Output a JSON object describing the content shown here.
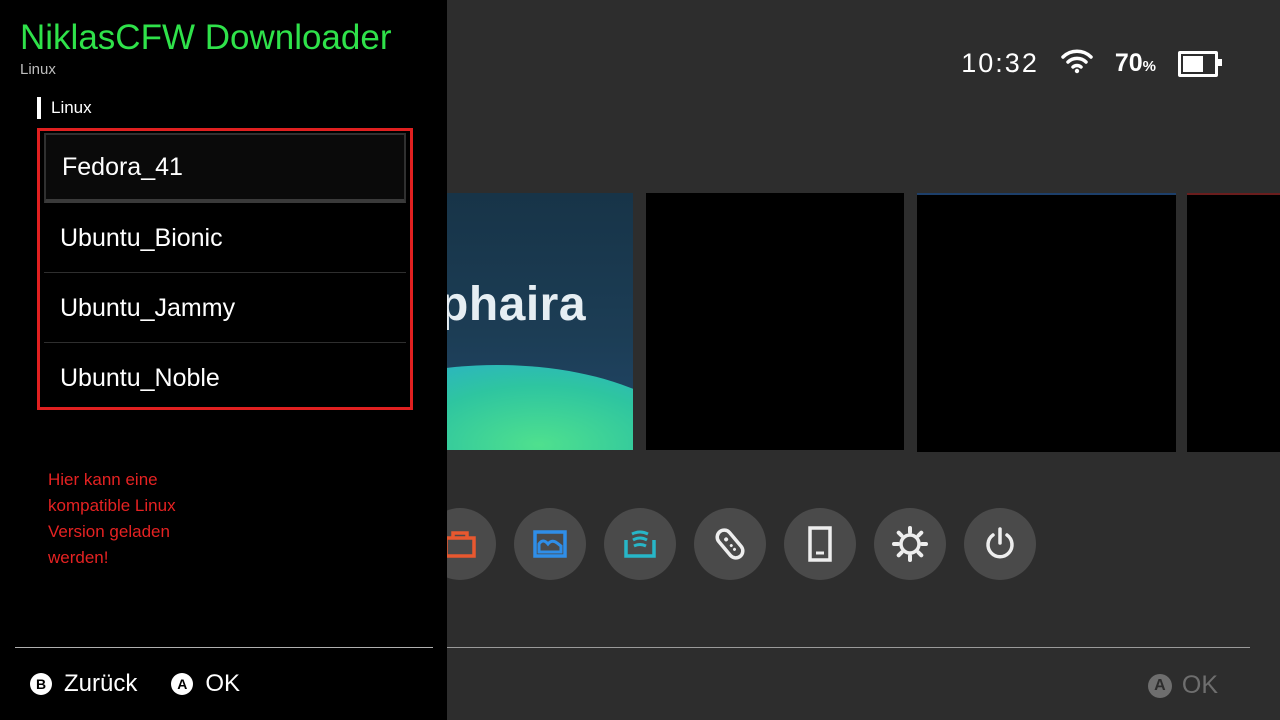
{
  "app": {
    "title": "NiklasCFW Downloader",
    "subtitle": "Linux"
  },
  "section": {
    "label": "Linux"
  },
  "distros": [
    {
      "label": "Fedora_41",
      "selected": true
    },
    {
      "label": "Ubuntu_Bionic",
      "selected": false
    },
    {
      "label": "Ubuntu_Jammy",
      "selected": false
    },
    {
      "label": "Ubuntu_Noble",
      "selected": false
    }
  ],
  "hint": "Hier kann eine kompatible Linux Version geladen werden!",
  "controls": {
    "back_key": "B",
    "back_label": "Zurück",
    "ok_key": "A",
    "ok_label": "OK"
  },
  "status_bar": {
    "time": "10:32",
    "battery_percent": "70",
    "battery_unit": "%",
    "wifi_icon": "wifi-icon",
    "battery_icon": "battery-icon"
  },
  "home": {
    "game_tile_text": "phaira",
    "ok_key": "A",
    "ok_label": "OK",
    "dock_icons": [
      "shop-icon",
      "album-icon",
      "news-icon",
      "controllers-icon",
      "system-update-icon",
      "settings-icon",
      "power-icon"
    ]
  },
  "colors": {
    "accent_green": "#2fe24a",
    "highlight_red": "#e02020",
    "hint_red": "#e52222",
    "panel_bg": "#000000",
    "home_bg": "#2d2d2d"
  }
}
